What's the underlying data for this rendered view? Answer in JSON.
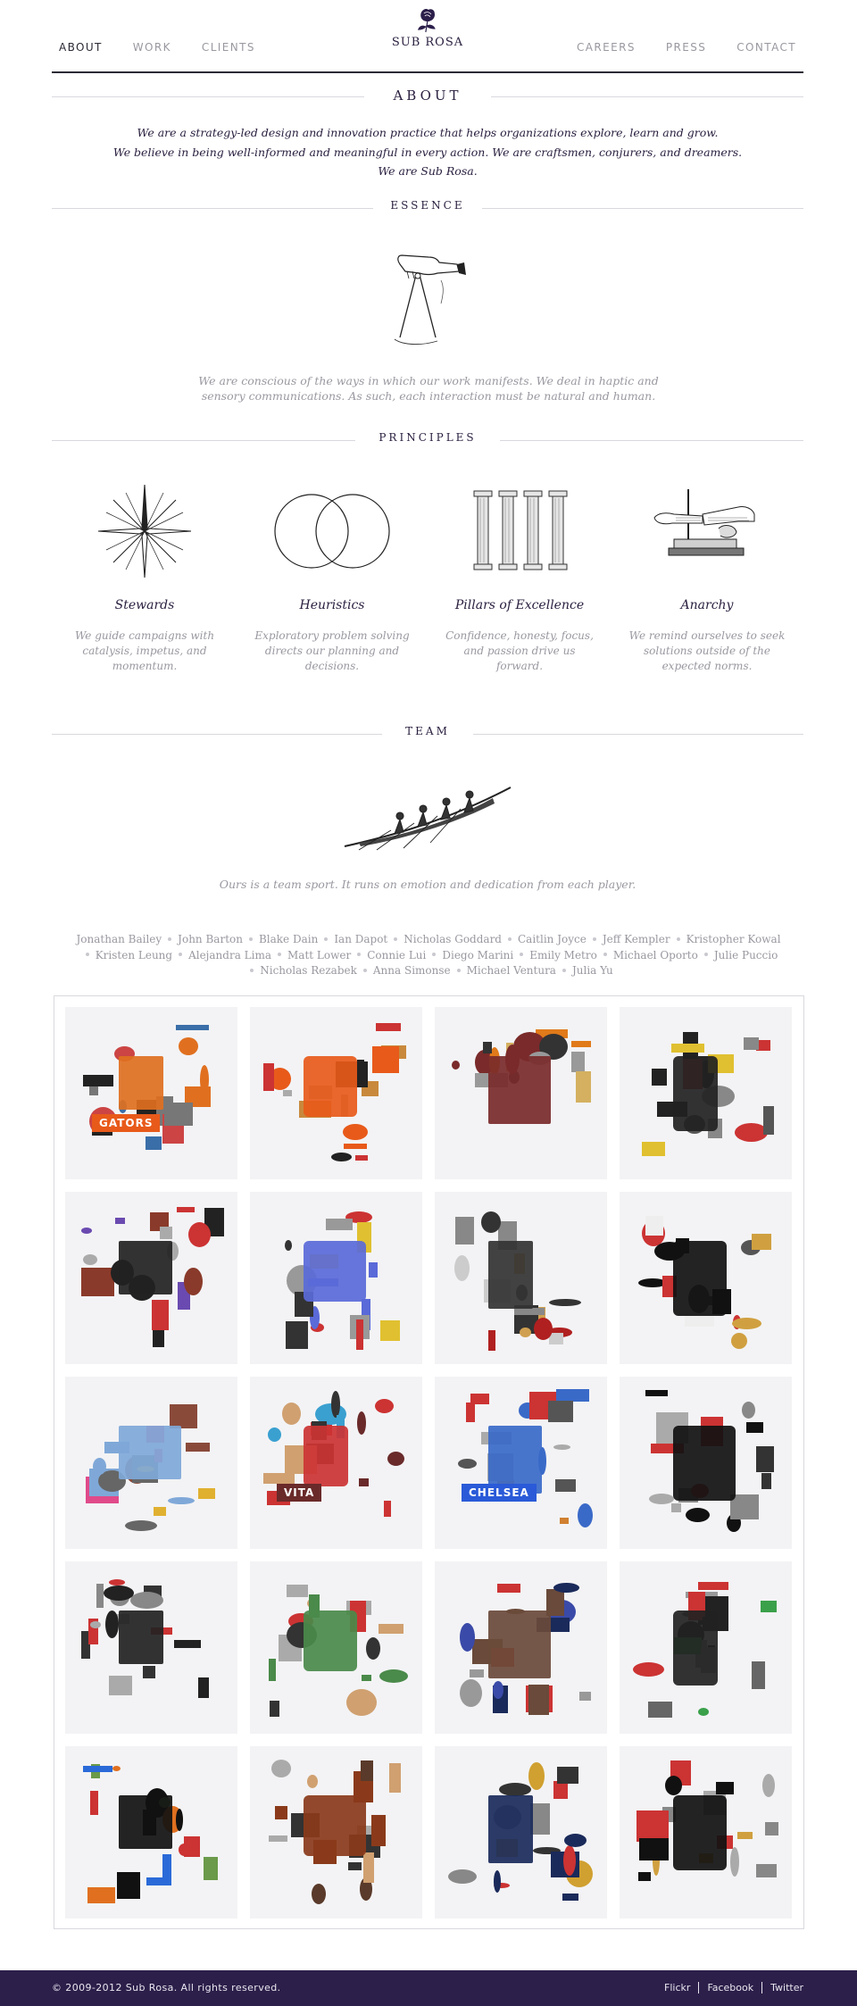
{
  "nav": {
    "left": [
      "ABOUT",
      "WORK",
      "CLIENTS"
    ],
    "right": [
      "CAREERS",
      "PRESS",
      "CONTACT"
    ],
    "active": "ABOUT"
  },
  "logo": {
    "name": "SUB ROSA",
    "icon": "rose-icon"
  },
  "about": {
    "heading": "ABOUT",
    "lines": [
      "We are a strategy-led design and innovation practice that helps organizations explore, learn and grow.",
      "We believe in being well-informed and meaningful in every action. We are craftsmen, conjurers, and dreamers.",
      "We are Sub Rosa."
    ]
  },
  "essence": {
    "heading": "ESSENCE",
    "icon": "hand-compass-icon",
    "text": "We are conscious of the ways in which our work manifests. We deal in haptic and sensory communications. As such, each interaction must be natural and human."
  },
  "principles": {
    "heading": "PRINCIPLES",
    "items": [
      {
        "title": "Stewards",
        "text": "We guide campaigns with catalysis, impetus, and momentum.",
        "icon": "compass-star-icon"
      },
      {
        "title": "Heuristics",
        "text": "Exploratory problem solving directs our planning and decisions.",
        "icon": "venn-circles-icon"
      },
      {
        "title": "Pillars of Excellence",
        "text": "Confidence, honesty, focus, and passion drive us forward.",
        "icon": "pillars-icon"
      },
      {
        "title": "Anarchy",
        "text": "We remind ourselves to seek solutions outside of the expected norms.",
        "icon": "hands-apparatus-icon"
      }
    ]
  },
  "team": {
    "heading": "TEAM",
    "icon": "rowing-crew-icon",
    "text": "Ours is a team sport. It runs on emotion and dedication from each player.",
    "members": [
      "Jonathan Bailey",
      "John Barton",
      "Blake Dain",
      "Ian Dapot",
      "Nicholas Goddard",
      "Caitlin Joyce",
      "Jeff Kempler",
      "Kristopher Kowal",
      "Kristen Leung",
      "Alejandra Lima",
      "Matt Lower",
      "Connie Lui",
      "Diego Marini",
      "Emily Metro",
      "Michael Oporto",
      "Julie Puccio",
      "Nicholas Rezabek",
      "Anna Simonse",
      "Michael Ventura",
      "Julia Yu"
    ],
    "photo_count": 20,
    "photo_labels": [
      "GATORS",
      "VITA",
      "CHELSEA"
    ]
  },
  "footer": {
    "copyright": "© 2009-2012 Sub Rosa. All rights reserved.",
    "links": [
      "Flickr",
      "Facebook",
      "Twitter"
    ]
  },
  "colors": {
    "brand": "#2c1f4a",
    "text": "#2b2040",
    "muted": "#9a98a0",
    "rule": "#d9d8de"
  }
}
